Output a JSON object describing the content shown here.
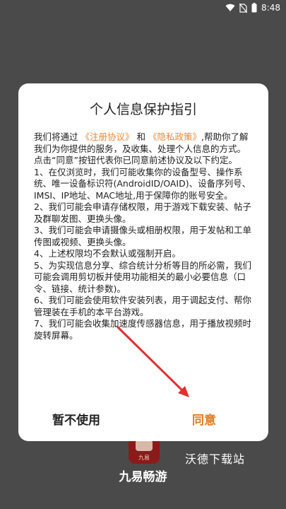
{
  "status_bar": {
    "time": "8:48",
    "icons": [
      "wifi-icon",
      "no-sim-icon",
      "battery-icon"
    ]
  },
  "background_app": {
    "icon_tag": "九易",
    "name": "九易畅游",
    "watermark": "沃德下载站"
  },
  "dialog": {
    "title": "个人信息保护指引",
    "intro_before": "我们将通过 ",
    "link_agreement": "《注册协议》",
    "intro_and": " 和 ",
    "link_privacy": "《隐私政策》",
    "intro_after": ",帮助你了解我们为你提供的服务，及收集、处理个人信息的方式。",
    "consent_line": " 点击“同意”按钮代表你已同意前述协议及以下约定。",
    "items": [
      " 1、在仅浏览时，我们可能收集你的设备型号、操作系统、唯一设备标识符(AndroidID/OAID)、设备序列号、IMSI、IP地址、MAC地址,用于保障你的账号安全。",
      " 2、我们可能会申请存储权限，用于游戏下载安装、帖子及群聊发图、更换头像。",
      " 3、我们可能会申请摄像头或相册权限，用于发帖和工单传图或视频、更换头像。",
      " 4、上述权限均不会默认或强制开启。",
      " 5、为实现信息分享、综合统计分析等目的所必需，我们可能会调用剪切板并使用功能相关的最小必要信息（口令、链接、统计参数)。",
      " 6、我们可能会使用软件安装列表，用于调起支付、帮你管理装在手机的本平台游戏。",
      " 7、我们可能会收集加速度传感器信息，用于播放视频时旋转屏幕。"
    ],
    "decline_label": "暂不使用",
    "agree_label": "同意"
  },
  "colors": {
    "link": "#e8893a",
    "agree": "#e07a1e",
    "annotation_arrow": "#e03030"
  }
}
